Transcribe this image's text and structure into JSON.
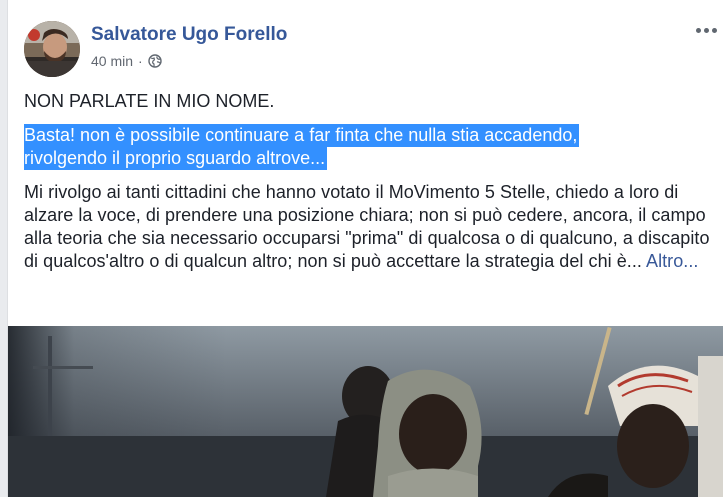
{
  "post": {
    "author": "Salvatore Ugo Forello",
    "time": "40 min",
    "separator": "·",
    "privacy_icon": "globe-icon",
    "menu_icon": "more-options-icon",
    "paragraph1": "NON PARLATE IN MIO NOME.",
    "highlight_line1": "Basta! non è possibile continuare a far finta che nulla stia accadendo,",
    "highlight_line2": "rivolgendo il proprio sguardo altrove...",
    "paragraph3": "Mi rivolgo ai tanti cittadini che hanno votato il MoVimento 5 Stelle, chiedo a loro di alzare la voce, di prendere una posizione chiara; non si può cedere, ancora, il campo alla teoria che sia necessario occuparsi \"prima\" di qualcosa o di qualcuno, a discapito di qualcos'altro o di qualcun altro; non si può accettare la strategia del chi è...",
    "more_link": "Altro..."
  },
  "colors": {
    "author": "#365899",
    "highlight_bg": "#3390ff",
    "link": "#385898",
    "meta": "#616770"
  }
}
